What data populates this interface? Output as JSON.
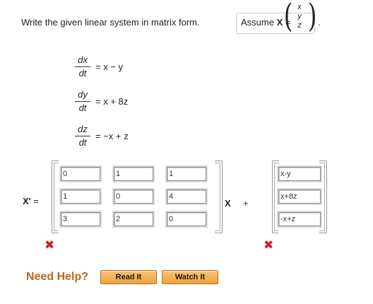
{
  "prompt": {
    "text": "Write the given linear system in matrix form.",
    "assume_label": "Assume",
    "assume_var": "X",
    "equals": "=",
    "vector": [
      "x",
      "y",
      "z"
    ],
    "period": "."
  },
  "equations": [
    {
      "numerator": "dx",
      "denominator": "dt",
      "rhs": "= x − y"
    },
    {
      "numerator": "dy",
      "denominator": "dt",
      "rhs": "= x + 8z"
    },
    {
      "numerator": "dz",
      "denominator": "dt",
      "rhs": "= −x + z"
    }
  ],
  "answer": {
    "lhs_var": "X'",
    "lhs_equals": "=",
    "matrix": [
      [
        "0",
        "1",
        "1"
      ],
      [
        "1",
        "0",
        "4"
      ],
      [
        "3",
        "2",
        "0"
      ]
    ],
    "operator_var": "X",
    "operator_plus": "+",
    "vector": [
      "x-y",
      "x+8z",
      "-x+z"
    ],
    "matrix_status": "incorrect",
    "vector_status": "incorrect",
    "status_icon": "x-mark-icon",
    "status_glyph": "✖"
  },
  "help": {
    "label": "Need Help?",
    "buttons": [
      {
        "label": "Read It"
      },
      {
        "label": "Watch It"
      }
    ]
  },
  "colors": {
    "incorrect": "#cc1f1f",
    "help_label": "#b8661b",
    "button_fill": "#f0a23c",
    "button_border": "#b56f1f"
  }
}
